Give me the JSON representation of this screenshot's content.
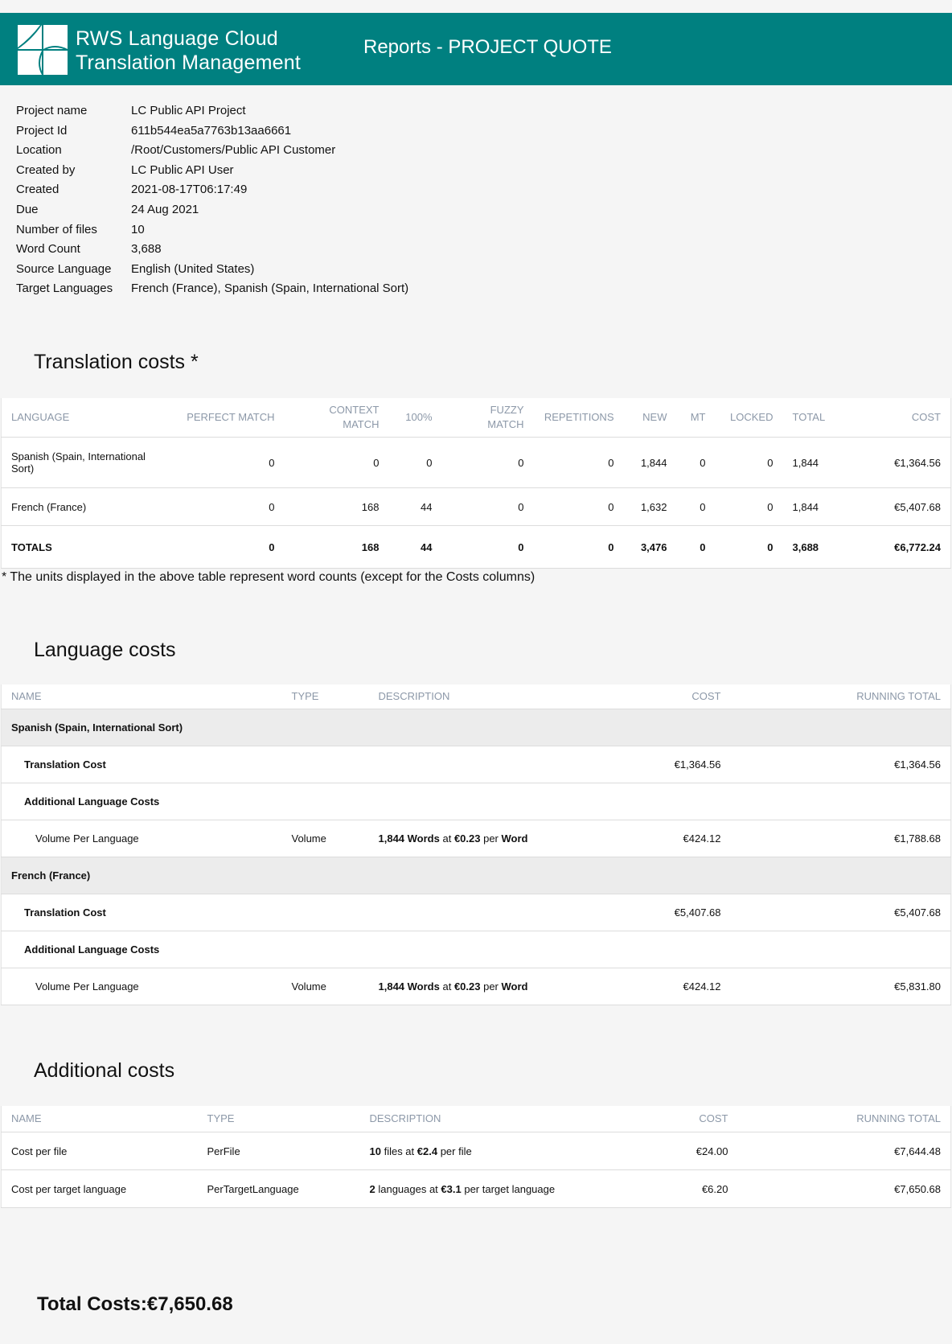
{
  "header": {
    "brand_line1": "RWS Language Cloud",
    "brand_line2": "Translation Management",
    "report_title": "Reports - PROJECT QUOTE",
    "bg_color": "#008080"
  },
  "project_info": [
    {
      "label": "Project name",
      "value": "LC Public API Project"
    },
    {
      "label": "Project Id",
      "value": "611b544ea5a7763b13aa6661"
    },
    {
      "label": "Location",
      "value": "/Root/Customers/Public API Customer"
    },
    {
      "label": "Created by",
      "value": "LC Public API User"
    },
    {
      "label": "Created",
      "value": "2021-08-17T06:17:49"
    },
    {
      "label": "Due",
      "value": "24 Aug 2021"
    },
    {
      "label": "Number of files",
      "value": "10"
    },
    {
      "label": "Word Count",
      "value": "3,688"
    },
    {
      "label": "Source Language",
      "value": "English (United States)"
    },
    {
      "label": "Target Languages",
      "value": "French (France), Spanish (Spain, International Sort)"
    }
  ],
  "translation_costs": {
    "title": "Translation costs *",
    "columns": [
      "LANGUAGE",
      "PERFECT MATCH",
      "CONTEXT MATCH",
      "100%",
      "FUZZY MATCH",
      "REPETITIONS",
      "NEW",
      "MT",
      "LOCKED",
      "TOTAL",
      "COST"
    ],
    "rows": [
      [
        "Spanish (Spain, International Sort)",
        "0",
        "0",
        "0",
        "0",
        "0",
        "1,844",
        "0",
        "0",
        "1,844",
        "€1,364.56"
      ],
      [
        "French (France)",
        "0",
        "168",
        "44",
        "0",
        "0",
        "1,632",
        "0",
        "0",
        "1,844",
        "€5,407.68"
      ]
    ],
    "totals": [
      "TOTALS",
      "0",
      "168",
      "44",
      "0",
      "0",
      "3,476",
      "0",
      "0",
      "3,688",
      "€6,772.24"
    ],
    "note": "* The units displayed in the above table represent word counts (except for the Costs columns)"
  },
  "language_costs": {
    "title": "Language costs",
    "columns": [
      "NAME",
      "TYPE",
      "DESCRIPTION",
      "COST",
      "RUNNING TOTAL"
    ],
    "groups": [
      {
        "language": "Spanish (Spain, International Sort)",
        "translation_label": "Translation Cost",
        "translation_cost": "€1,364.56",
        "translation_running": "€1,364.56",
        "additional_label": "Additional Language Costs",
        "item": {
          "name": "Volume Per Language",
          "type": "Volume",
          "d1": "1,844 Words",
          "d2": " at ",
          "d3": "€0.23",
          "d4": " per ",
          "d5": "Word",
          "cost": "€424.12",
          "running": "€1,788.68"
        }
      },
      {
        "language": "French (France)",
        "translation_label": "Translation Cost",
        "translation_cost": "€5,407.68",
        "translation_running": "€5,407.68",
        "additional_label": "Additional Language Costs",
        "item": {
          "name": "Volume Per Language",
          "type": "Volume",
          "d1": "1,844 Words",
          "d2": " at ",
          "d3": "€0.23",
          "d4": " per ",
          "d5": "Word",
          "cost": "€424.12",
          "running": "€5,831.80"
        }
      }
    ]
  },
  "additional_costs": {
    "title": "Additional costs",
    "columns": [
      "NAME",
      "TYPE",
      "DESCRIPTION",
      "COST",
      "RUNNING TOTAL"
    ],
    "rows": [
      {
        "name": "Cost per file",
        "type": "PerFile",
        "d1": "10",
        "d2": " files at ",
        "d3": "€2.4",
        "d4": " per file",
        "cost": "€24.00",
        "running": "€7,644.48"
      },
      {
        "name": "Cost per target language",
        "type": "PerTargetLanguage",
        "d1": "2",
        "d2": " languages at ",
        "d3": "€3.1",
        "d4": " per target language",
        "cost": "€6.20",
        "running": "€7,650.68"
      }
    ]
  },
  "total_costs": {
    "label": "Total Costs:",
    "value": "€7,650.68"
  }
}
